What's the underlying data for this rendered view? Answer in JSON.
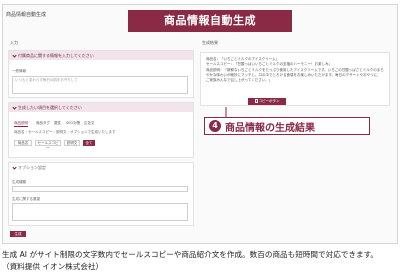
{
  "app_title": "商品情報自動生成",
  "headline": "商品情報自動生成",
  "input_column_label": "入力",
  "output_column_label": "生成結果",
  "panel1": {
    "header": "付属商品に関する情報を入力してください",
    "field_label": "一般情報",
    "field_value": "いつもと変わらず毎日の肌をお守りして"
  },
  "panel2": {
    "header": "生成したい項目を選択してください",
    "tabs": [
      "商品説明",
      "商品タグ",
      "属性",
      "SEO対策",
      "広告文"
    ],
    "description": "商品名・セールスコピー・説明文・オプションで生成いたします",
    "chips": [
      "商品名",
      "セールスコピー",
      "説明文",
      "全て"
    ]
  },
  "panel3": {
    "header": "オプション設定",
    "field1_label": "生成種類",
    "field2_label": "生成に関する要望"
  },
  "submit_label": "生成",
  "result": {
    "line1": "商品名：「いちごとミルクのアイスクリーム」",
    "line2": "セールスコピー：「甘酸っぱいいちごとミルクの至福のハーモニー！お楽しみ」",
    "line3": "商品説明：「新鮮ないちごとミルクをたっぷり使用したアイスクリームです。いちごの甘酸っぱさとミルクのまろやかな味わいが絶妙にマッチし、口の中でとろける食感をお楽しみいただけます。毎日のデザートやおやつに、ご家族みんなで召し上がってください。」"
  },
  "copy_button": "コピーボタン",
  "callout": {
    "number": "4",
    "text": "商品情報の生成結果"
  },
  "caption": {
    "line1": "生成 AI がサイト制限の文字数内でセールスコピーや商品紹介文を作成。数百の商品も短時間で対応できます。",
    "line2": "（資料提供 イオン株式会社）"
  },
  "colors": {
    "accent": "#8a2a45",
    "panel_head": "#f2e4ea"
  }
}
